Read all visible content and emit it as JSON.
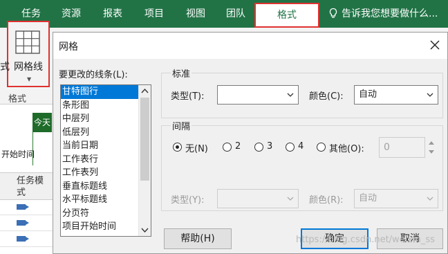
{
  "ribbon": {
    "tabs": [
      {
        "label": "任务"
      },
      {
        "label": "资源"
      },
      {
        "label": "报表"
      },
      {
        "label": "项目"
      },
      {
        "label": "视图"
      },
      {
        "label": "团队"
      },
      {
        "label": "格式"
      }
    ],
    "tell_me": "告诉我您想要做什么...",
    "gridlines_button_label": "网格线",
    "left_cut_text": "式",
    "group_label": "格式"
  },
  "background": {
    "today_label": "今天",
    "start_time_label": "开始时间",
    "column_header": "任务模式"
  },
  "dialog": {
    "title": "网格",
    "line_to_change_label": "要更改的线条(L):",
    "line_items": [
      "甘特图行",
      "条形图",
      "中层列",
      "低层列",
      "当前日期",
      "工作表行",
      "工作表列",
      "垂直标题线",
      "水平标题线",
      "分页符",
      "项目开始时间"
    ],
    "selected_index": 0,
    "normal": {
      "title": "标准",
      "type_label": "类型(T):",
      "type_value": "",
      "color_label": "颜色(C):",
      "color_value": "自动"
    },
    "interval": {
      "title": "间隔",
      "options": [
        "无(N)",
        "2",
        "3",
        "4",
        "其他(O):"
      ],
      "selected_option": "无(N)",
      "other_value": "0",
      "type_label": "类型(Y):",
      "type_value": "",
      "color_label": "颜色(R):",
      "color_value": "自动"
    },
    "buttons": {
      "help": "帮助(H)",
      "ok": "确定",
      "cancel": "取消"
    }
  },
  "watermark": "https://blog.csdn.net/weixin_ss",
  "colors": {
    "ribbon_green": "#217346",
    "highlight_red": "#e03030",
    "selection_blue": "#0078d7"
  }
}
